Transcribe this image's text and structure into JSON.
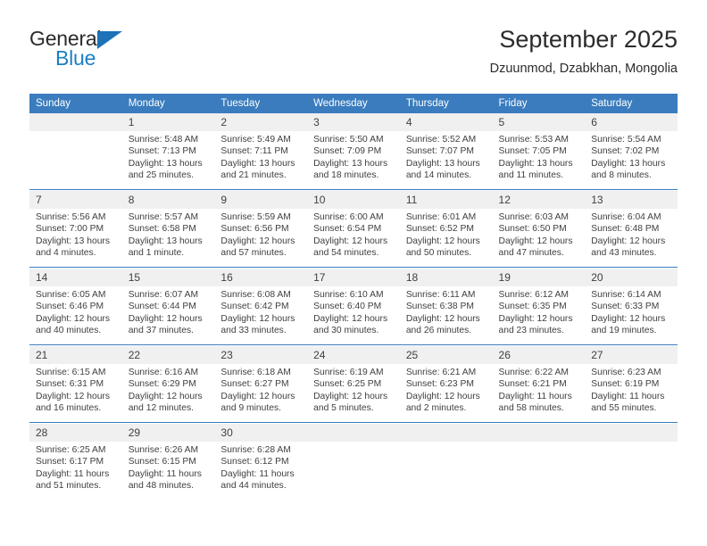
{
  "brand": {
    "name_top": "General",
    "name_bottom": "Blue",
    "triangle_color": "#1d72b8",
    "blue_color": "#1b7fc4"
  },
  "header": {
    "title": "September 2025",
    "subtitle": "Dzuunmod, Dzabkhan, Mongolia"
  },
  "theme": {
    "header_bg": "#3a7cbe",
    "header_text": "#ffffff",
    "daynum_bg": "#f0f0f0",
    "separator": "#3a7cbe",
    "body_text": "#3f3f3f"
  },
  "weekdays": [
    "Sunday",
    "Monday",
    "Tuesday",
    "Wednesday",
    "Thursday",
    "Friday",
    "Saturday"
  ],
  "labels": {
    "sunrise": "Sunrise:",
    "sunset": "Sunset:",
    "daylight": "Daylight:"
  },
  "weeks": [
    {
      "days": [
        {
          "num": "",
          "sunrise": "",
          "sunset": "",
          "daylight_a": "",
          "daylight_b": ""
        },
        {
          "num": "1",
          "sunrise": "Sunrise: 5:48 AM",
          "sunset": "Sunset: 7:13 PM",
          "daylight_a": "Daylight: 13 hours",
          "daylight_b": "and 25 minutes."
        },
        {
          "num": "2",
          "sunrise": "Sunrise: 5:49 AM",
          "sunset": "Sunset: 7:11 PM",
          "daylight_a": "Daylight: 13 hours",
          "daylight_b": "and 21 minutes."
        },
        {
          "num": "3",
          "sunrise": "Sunrise: 5:50 AM",
          "sunset": "Sunset: 7:09 PM",
          "daylight_a": "Daylight: 13 hours",
          "daylight_b": "and 18 minutes."
        },
        {
          "num": "4",
          "sunrise": "Sunrise: 5:52 AM",
          "sunset": "Sunset: 7:07 PM",
          "daylight_a": "Daylight: 13 hours",
          "daylight_b": "and 14 minutes."
        },
        {
          "num": "5",
          "sunrise": "Sunrise: 5:53 AM",
          "sunset": "Sunset: 7:05 PM",
          "daylight_a": "Daylight: 13 hours",
          "daylight_b": "and 11 minutes."
        },
        {
          "num": "6",
          "sunrise": "Sunrise: 5:54 AM",
          "sunset": "Sunset: 7:02 PM",
          "daylight_a": "Daylight: 13 hours",
          "daylight_b": "and 8 minutes."
        }
      ]
    },
    {
      "days": [
        {
          "num": "7",
          "sunrise": "Sunrise: 5:56 AM",
          "sunset": "Sunset: 7:00 PM",
          "daylight_a": "Daylight: 13 hours",
          "daylight_b": "and 4 minutes."
        },
        {
          "num": "8",
          "sunrise": "Sunrise: 5:57 AM",
          "sunset": "Sunset: 6:58 PM",
          "daylight_a": "Daylight: 13 hours",
          "daylight_b": "and 1 minute."
        },
        {
          "num": "9",
          "sunrise": "Sunrise: 5:59 AM",
          "sunset": "Sunset: 6:56 PM",
          "daylight_a": "Daylight: 12 hours",
          "daylight_b": "and 57 minutes."
        },
        {
          "num": "10",
          "sunrise": "Sunrise: 6:00 AM",
          "sunset": "Sunset: 6:54 PM",
          "daylight_a": "Daylight: 12 hours",
          "daylight_b": "and 54 minutes."
        },
        {
          "num": "11",
          "sunrise": "Sunrise: 6:01 AM",
          "sunset": "Sunset: 6:52 PM",
          "daylight_a": "Daylight: 12 hours",
          "daylight_b": "and 50 minutes."
        },
        {
          "num": "12",
          "sunrise": "Sunrise: 6:03 AM",
          "sunset": "Sunset: 6:50 PM",
          "daylight_a": "Daylight: 12 hours",
          "daylight_b": "and 47 minutes."
        },
        {
          "num": "13",
          "sunrise": "Sunrise: 6:04 AM",
          "sunset": "Sunset: 6:48 PM",
          "daylight_a": "Daylight: 12 hours",
          "daylight_b": "and 43 minutes."
        }
      ]
    },
    {
      "days": [
        {
          "num": "14",
          "sunrise": "Sunrise: 6:05 AM",
          "sunset": "Sunset: 6:46 PM",
          "daylight_a": "Daylight: 12 hours",
          "daylight_b": "and 40 minutes."
        },
        {
          "num": "15",
          "sunrise": "Sunrise: 6:07 AM",
          "sunset": "Sunset: 6:44 PM",
          "daylight_a": "Daylight: 12 hours",
          "daylight_b": "and 37 minutes."
        },
        {
          "num": "16",
          "sunrise": "Sunrise: 6:08 AM",
          "sunset": "Sunset: 6:42 PM",
          "daylight_a": "Daylight: 12 hours",
          "daylight_b": "and 33 minutes."
        },
        {
          "num": "17",
          "sunrise": "Sunrise: 6:10 AM",
          "sunset": "Sunset: 6:40 PM",
          "daylight_a": "Daylight: 12 hours",
          "daylight_b": "and 30 minutes."
        },
        {
          "num": "18",
          "sunrise": "Sunrise: 6:11 AM",
          "sunset": "Sunset: 6:38 PM",
          "daylight_a": "Daylight: 12 hours",
          "daylight_b": "and 26 minutes."
        },
        {
          "num": "19",
          "sunrise": "Sunrise: 6:12 AM",
          "sunset": "Sunset: 6:35 PM",
          "daylight_a": "Daylight: 12 hours",
          "daylight_b": "and 23 minutes."
        },
        {
          "num": "20",
          "sunrise": "Sunrise: 6:14 AM",
          "sunset": "Sunset: 6:33 PM",
          "daylight_a": "Daylight: 12 hours",
          "daylight_b": "and 19 minutes."
        }
      ]
    },
    {
      "days": [
        {
          "num": "21",
          "sunrise": "Sunrise: 6:15 AM",
          "sunset": "Sunset: 6:31 PM",
          "daylight_a": "Daylight: 12 hours",
          "daylight_b": "and 16 minutes."
        },
        {
          "num": "22",
          "sunrise": "Sunrise: 6:16 AM",
          "sunset": "Sunset: 6:29 PM",
          "daylight_a": "Daylight: 12 hours",
          "daylight_b": "and 12 minutes."
        },
        {
          "num": "23",
          "sunrise": "Sunrise: 6:18 AM",
          "sunset": "Sunset: 6:27 PM",
          "daylight_a": "Daylight: 12 hours",
          "daylight_b": "and 9 minutes."
        },
        {
          "num": "24",
          "sunrise": "Sunrise: 6:19 AM",
          "sunset": "Sunset: 6:25 PM",
          "daylight_a": "Daylight: 12 hours",
          "daylight_b": "and 5 minutes."
        },
        {
          "num": "25",
          "sunrise": "Sunrise: 6:21 AM",
          "sunset": "Sunset: 6:23 PM",
          "daylight_a": "Daylight: 12 hours",
          "daylight_b": "and 2 minutes."
        },
        {
          "num": "26",
          "sunrise": "Sunrise: 6:22 AM",
          "sunset": "Sunset: 6:21 PM",
          "daylight_a": "Daylight: 11 hours",
          "daylight_b": "and 58 minutes."
        },
        {
          "num": "27",
          "sunrise": "Sunrise: 6:23 AM",
          "sunset": "Sunset: 6:19 PM",
          "daylight_a": "Daylight: 11 hours",
          "daylight_b": "and 55 minutes."
        }
      ]
    },
    {
      "days": [
        {
          "num": "28",
          "sunrise": "Sunrise: 6:25 AM",
          "sunset": "Sunset: 6:17 PM",
          "daylight_a": "Daylight: 11 hours",
          "daylight_b": "and 51 minutes."
        },
        {
          "num": "29",
          "sunrise": "Sunrise: 6:26 AM",
          "sunset": "Sunset: 6:15 PM",
          "daylight_a": "Daylight: 11 hours",
          "daylight_b": "and 48 minutes."
        },
        {
          "num": "30",
          "sunrise": "Sunrise: 6:28 AM",
          "sunset": "Sunset: 6:12 PM",
          "daylight_a": "Daylight: 11 hours",
          "daylight_b": "and 44 minutes."
        },
        {
          "num": "",
          "sunrise": "",
          "sunset": "",
          "daylight_a": "",
          "daylight_b": ""
        },
        {
          "num": "",
          "sunrise": "",
          "sunset": "",
          "daylight_a": "",
          "daylight_b": ""
        },
        {
          "num": "",
          "sunrise": "",
          "sunset": "",
          "daylight_a": "",
          "daylight_b": ""
        },
        {
          "num": "",
          "sunrise": "",
          "sunset": "",
          "daylight_a": "",
          "daylight_b": ""
        }
      ]
    }
  ]
}
